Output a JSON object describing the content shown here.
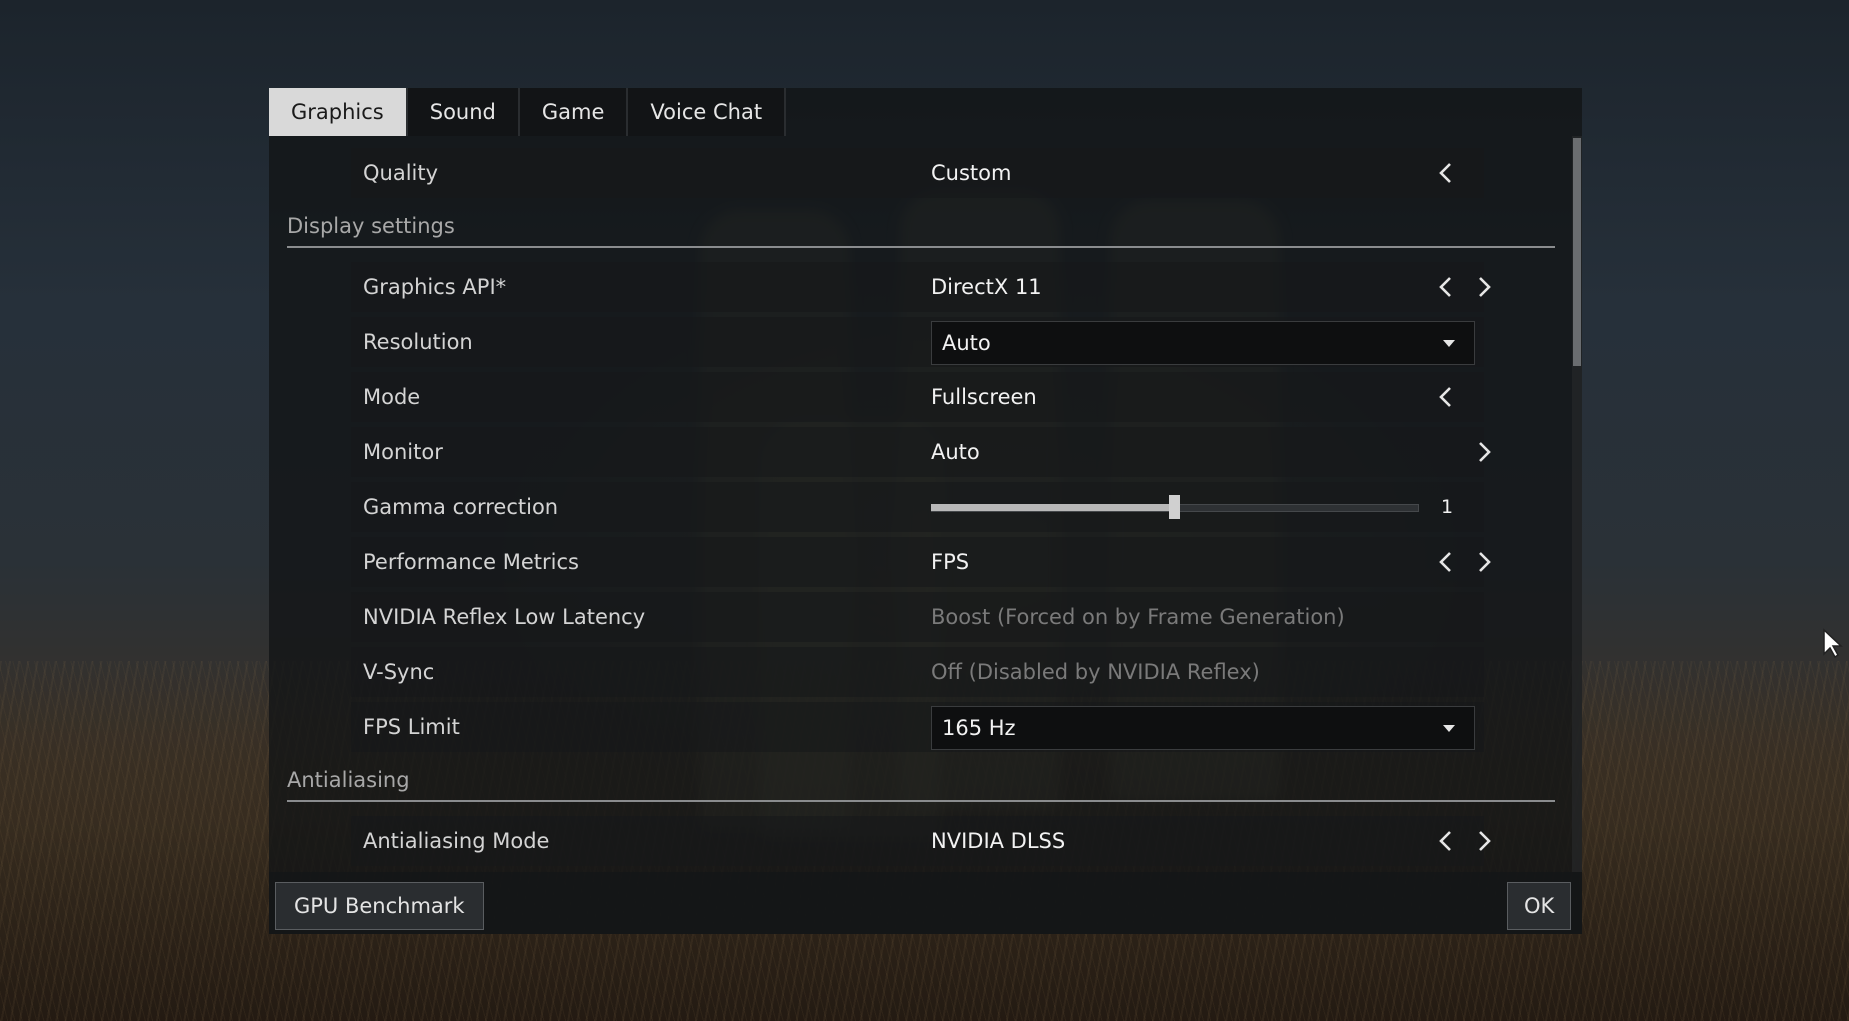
{
  "tabs": [
    "Graphics",
    "Sound",
    "Game",
    "Voice Chat"
  ],
  "active_tab": "Graphics",
  "quality": {
    "label": "Quality",
    "value": "Custom"
  },
  "sections": {
    "display": "Display settings",
    "antialiasing": "Antialiasing"
  },
  "rows": {
    "graphics_api": {
      "label": "Graphics API*",
      "value": "DirectX 11"
    },
    "resolution": {
      "label": "Resolution",
      "value": "Auto"
    },
    "mode": {
      "label": "Mode",
      "value": "Fullscreen"
    },
    "monitor": {
      "label": "Monitor",
      "value": "Auto"
    },
    "gamma": {
      "label": "Gamma correction",
      "value": "1",
      "slider_fraction": 0.5
    },
    "performance_metrics": {
      "label": "Performance Metrics",
      "value": "FPS"
    },
    "reflex": {
      "label": "NVIDIA Reflex Low Latency",
      "value": "Boost (Forced on by Frame Generation)"
    },
    "vsync": {
      "label": "V-Sync",
      "value": "Off (Disabled by NVIDIA Reflex)"
    },
    "fps_limit": {
      "label": "FPS Limit",
      "value": "165 Hz"
    },
    "aa_mode": {
      "label": "Antialiasing Mode",
      "value": "NVIDIA DLSS"
    }
  },
  "footer": {
    "benchmark": "GPU Benchmark",
    "ok": "OK"
  },
  "icons": [
    "chevron-left-icon",
    "chevron-right-icon",
    "caret-down-icon",
    "mouse-cursor-icon"
  ],
  "colors": {
    "panel": "#121416",
    "active_tab": "#d9d9d9",
    "disabled_text": "#7a7a7a"
  }
}
